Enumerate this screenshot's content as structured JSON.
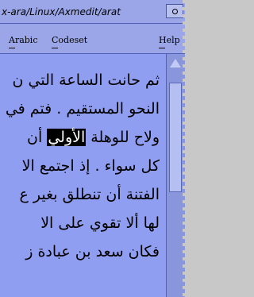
{
  "window": {
    "title": "x-ara/Linux/Axmedit/arat"
  },
  "menubar": {
    "items": [
      {
        "label": "Arabic"
      },
      {
        "label": "Codeset"
      },
      {
        "label": "Help"
      }
    ]
  },
  "document": {
    "lines": [
      {
        "text": "ثم حانت الساعة التي ن"
      },
      {
        "text": "النحو المستقيم . فتم في"
      },
      {
        "before": "ولاح للوهلة ",
        "highlight": "الأولي",
        "after": " أن"
      },
      {
        "text": "كل سواء . إذ اجتمع الا"
      },
      {
        "text": "الفتنة أن تنطلق بغير ع"
      },
      {
        "text": "لها ألا تقوي على الا"
      },
      {
        "text": "فكان سعد بن عبادة ز"
      }
    ]
  },
  "colors": {
    "background": "#9aa6e8",
    "highlight": "#000000"
  }
}
